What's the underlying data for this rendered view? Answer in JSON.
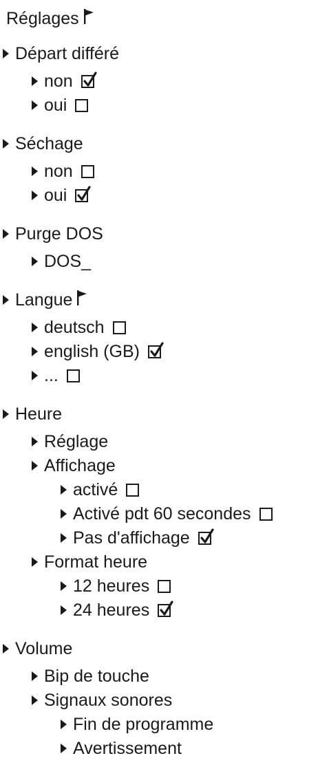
{
  "title": "Réglages",
  "items": [
    {
      "label": "Départ différé",
      "level": 0,
      "checkbox": null,
      "flag": false
    },
    {
      "label": "non",
      "level": 1,
      "checkbox": true,
      "flag": false
    },
    {
      "label": "oui",
      "level": 1,
      "checkbox": false,
      "flag": false
    },
    {
      "label": "Séchage",
      "level": 0,
      "checkbox": null,
      "flag": false
    },
    {
      "label": "non",
      "level": 1,
      "checkbox": false,
      "flag": false
    },
    {
      "label": "oui",
      "level": 1,
      "checkbox": true,
      "flag": false
    },
    {
      "label": "Purge DOS",
      "level": 0,
      "checkbox": null,
      "flag": false
    },
    {
      "label": "DOS_",
      "level": 1,
      "checkbox": null,
      "flag": false
    },
    {
      "label": "Langue",
      "level": 0,
      "checkbox": null,
      "flag": true
    },
    {
      "label": "deutsch",
      "level": 1,
      "checkbox": false,
      "flag": false
    },
    {
      "label": "english (GB)",
      "level": 1,
      "checkbox": true,
      "flag": false
    },
    {
      "label": "...",
      "level": 1,
      "checkbox": false,
      "flag": false
    },
    {
      "label": "Heure",
      "level": 0,
      "checkbox": null,
      "flag": false
    },
    {
      "label": "Réglage",
      "level": 1,
      "checkbox": null,
      "flag": false
    },
    {
      "label": "Affichage",
      "level": 1,
      "checkbox": null,
      "flag": false
    },
    {
      "label": "activé",
      "level": 2,
      "checkbox": false,
      "flag": false
    },
    {
      "label": "Activé pdt 60 secondes",
      "level": 2,
      "checkbox": false,
      "flag": false
    },
    {
      "label": "Pas d'affichage",
      "level": 2,
      "checkbox": true,
      "flag": false
    },
    {
      "label": "Format heure",
      "level": 1,
      "checkbox": null,
      "flag": false
    },
    {
      "label": "12 heures",
      "level": 2,
      "checkbox": false,
      "flag": false
    },
    {
      "label": "24 heures",
      "level": 2,
      "checkbox": true,
      "flag": false
    },
    {
      "label": "Volume",
      "level": 0,
      "checkbox": null,
      "flag": false
    },
    {
      "label": "Bip de touche",
      "level": 1,
      "checkbox": null,
      "flag": false
    },
    {
      "label": "Signaux sonores",
      "level": 1,
      "checkbox": null,
      "flag": false
    },
    {
      "label": "Fin de programme",
      "level": 2,
      "checkbox": null,
      "flag": false
    },
    {
      "label": "Avertissement",
      "level": 2,
      "checkbox": null,
      "flag": false
    }
  ]
}
